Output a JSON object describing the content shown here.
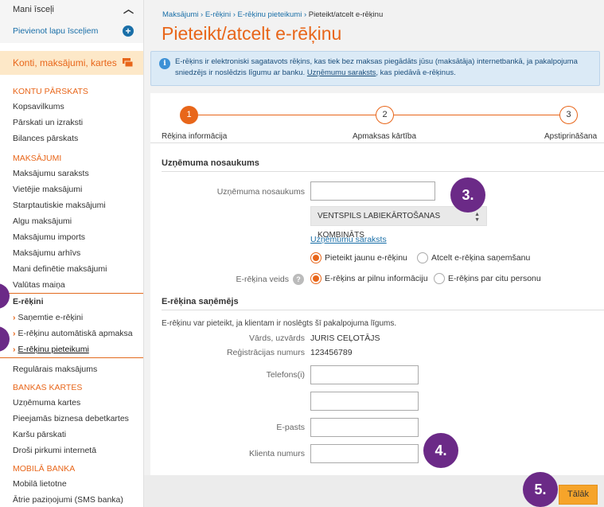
{
  "sidebar": {
    "my_shortcuts": "Mani īsceļi",
    "add_shortcut": "Pievienot lapu īsceļiem",
    "section_main": "Konti, maksājumi, kartes",
    "account_review": {
      "title": "KONTU PĀRSKATS",
      "items": [
        "Kopsavilkums",
        "Pārskati un izraksti",
        "Bilances pārskats"
      ]
    },
    "payments": {
      "title": "MAKSĀJUMI",
      "items": [
        "Maksājumu saraksts",
        "Vietējie maksājumi",
        "Starptautiskie maksājumi",
        "Algu maksājumi",
        "Maksājumu imports",
        "Maksājumu arhīvs",
        "Mani definētie maksājumi",
        "Valūtas maiņa"
      ]
    },
    "einvoice": {
      "title": "E-rēķini",
      "items": [
        "Saņemtie e-rēķini",
        "E-rēķinu automātiskā apmaksa",
        "E-rēķinu pieteikumi"
      ]
    },
    "regular_payments": "Regulārais maksājums",
    "bank_cards": {
      "title": "BANKAS KARTES",
      "items": [
        "Uzņēmuma kartes",
        "Pieejamās biznesa debetkartes",
        "Karšu pārskati",
        "Droši pirkumi internetā"
      ]
    },
    "mobile_bank": {
      "title": "MOBILĀ BANKA",
      "items": [
        "Mobilā lietotne",
        "Ātrie paziņojumi (SMS banka)"
      ]
    }
  },
  "breadcrumb": {
    "items": [
      "Maksājumi",
      "E-rēķini",
      "E-rēķinu pieteikumi"
    ],
    "current": "Pieteikt/atcelt e-rēķinu",
    "separator": "›"
  },
  "page_title": "Pieteikt/atcelt e-rēķinu",
  "info": {
    "text": "E-rēķins ir elektroniski sagatavots rēķins, kas tiek bez maksas piegādāts jūsu (maksātāja) internetbankā, ja pakalpojuma sniedzējs ir noslēdzis līgumu ar banku.",
    "link": "Uzņēmumu saraksts",
    "suffix": ", kas piedāvā e-rēķinus."
  },
  "steps": [
    {
      "number": "1",
      "label": "Rēķina informācija"
    },
    {
      "number": "2",
      "label": "Apmaksas kārtība"
    },
    {
      "number": "3",
      "label": "Apstiprināšana"
    }
  ],
  "company": {
    "section_title": "Uzņēmuma nosaukums",
    "name_label": "Uzņēmuma nosaukums",
    "name_value": "",
    "select_value": "VENTSPILS LABIEKĀRTOŠANAS KOMBINĀTS",
    "list_link": "Uzņēmumu saraksts",
    "action_options": [
      "Pieteikt jaunu e-rēķinu",
      "Atcelt e-rēķina saņemšanu"
    ],
    "type_label": "E-rēķina veids",
    "type_options": [
      "E-rēķins ar pilnu informāciju",
      "E-rēķins par citu personu"
    ]
  },
  "recipient": {
    "section_title": "E-rēķina saņēmējs",
    "note": "E-rēķinu var pieteikt, ja klientam ir noslēgts šī pakalpojuma līgums.",
    "name_label": "Vārds, uzvārds",
    "name_value": "JURIS CEĻOTĀJS",
    "reg_label": "Reģistrācijas numurs",
    "reg_value": "123456789",
    "phone_label": "Telefons(i)",
    "email_label": "E-pasts",
    "client_label": "Klienta numurs"
  },
  "callouts": [
    "3.",
    "4.",
    "5."
  ],
  "next_button": "Tālāk",
  "colors": {
    "accent": "#e8661a",
    "link": "#1a6fa8",
    "callout": "#6b2a87",
    "button": "#f6a42a"
  }
}
